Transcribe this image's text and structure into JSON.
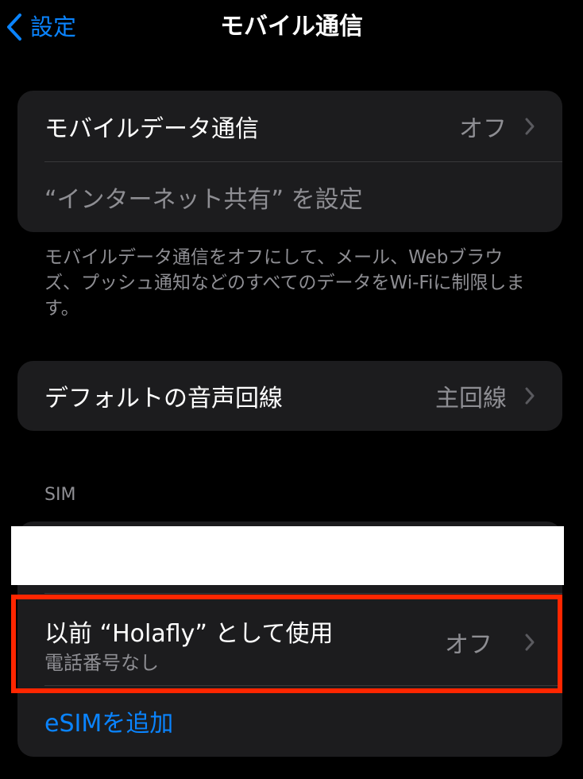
{
  "nav": {
    "back_label": "設定",
    "title": "モバイル通信"
  },
  "mobile_data": {
    "label": "モバイルデータ通信",
    "value": "オフ",
    "hotspot_label": "“インターネット共有” を設定",
    "footnote": "モバイルデータ通信をオフにして、メール、Webブラウズ、プッシュ通知などのすべてのデータをWi-Fiに制限します。"
  },
  "default_voice": {
    "label": "デフォルトの音声回線",
    "value": "主回線"
  },
  "sim_section": {
    "header": "SIM",
    "previous_plan": {
      "title": "以前 “Holafly” として使用",
      "subtitle": "電話番号なし",
      "value": "オフ"
    },
    "add_esim_label": "eSIMを追加"
  },
  "colors": {
    "accent": "#0a84ff",
    "highlight_border": "#ff2600",
    "cell_background": "#1c1c1e",
    "secondary_text": "#8e8e93"
  }
}
